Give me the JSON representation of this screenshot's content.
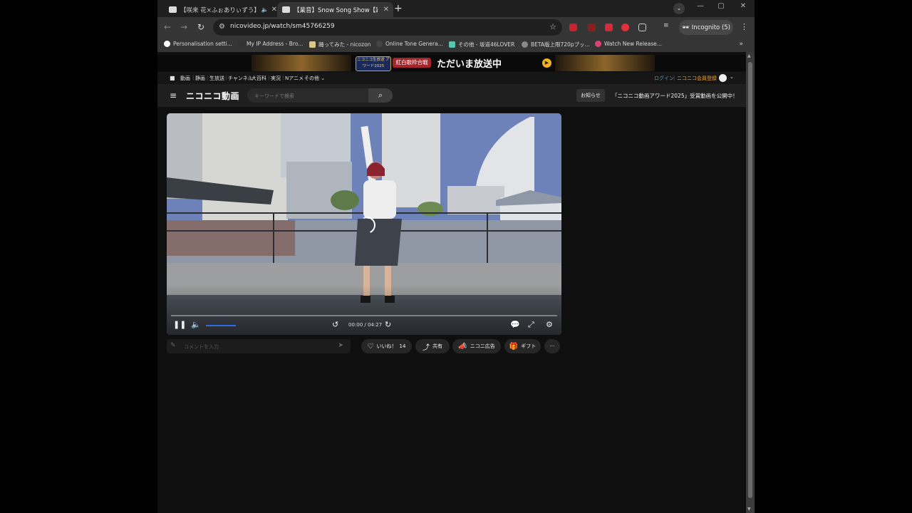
{
  "browser": {
    "tabs": [
      {
        "title": "【咲来 花×ふぉありぃずう】Snow",
        "audio_icon": "🔈"
      },
      {
        "title": "【業音】Snow Song Show【踊ってみた】"
      }
    ],
    "url": "nicovideo.jp/watch/sm45766259",
    "incognito_label": "Incognito (5)",
    "bookmarks": [
      {
        "label": "Personalisation setti...",
        "icon_color": "#ffffff"
      },
      {
        "label": "My IP Address - Bro...",
        "icon_color": "#333333"
      },
      {
        "label": "踊ってみた - nicozon",
        "icon_color": "#d8c98a"
      },
      {
        "label": "Online Tone Genera...",
        "icon_color": "#444444"
      },
      {
        "label": "その他 - 坂道46LOVER",
        "icon_color": "#58c4b0"
      },
      {
        "label": "BETA版上限720pプッ...",
        "icon_color": "#888888"
      },
      {
        "label": "Watch New Release...",
        "icon_color": "#e0407a"
      }
    ],
    "bookmarks_more": "»"
  },
  "site": {
    "banner": {
      "badge_text": "ニコニコ生放送 アワード2025",
      "kouhaku_text": "紅白歌枠合戦",
      "onair_text": "ただいま放送中"
    },
    "global_nav": [
      "動画",
      "静画",
      "生放送",
      "チャンネル",
      "大百科",
      "実況",
      "Nアニメ",
      "その他"
    ],
    "login_label": "ログイン",
    "register_label": "ニコニコ会員登録",
    "logo_text": "ニコニコ動画",
    "search_placeholder": "キーワードで検索",
    "notice_button": "お知らせ",
    "notice_text": "「ニコニコ動画アワード2025」受賞動画を公開中！"
  },
  "player": {
    "time_display": "00:00 / 04:27",
    "progress": 0,
    "volume": 0.6
  },
  "actions": {
    "comment_placeholder": "コメントを入力",
    "like_label": "いいね！",
    "like_count": "14",
    "share_label": "共有",
    "ad_label": "ニコニ広告",
    "gift_label": "ギフト",
    "more_label": "···"
  }
}
